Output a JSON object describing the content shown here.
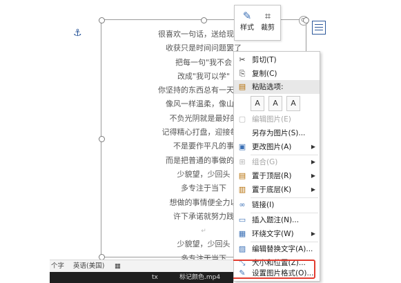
{
  "document": {
    "poem_lines": [
      "很喜欢一句话，送给现在的",
      "收获只是时间问题罢了",
      "把每一句\"我不会",
      "改成\"我可以学\"",
      "你坚持的东西总有一天会反",
      "像风一样温柔，像山一",
      "不负光阴就是最好的",
      "记得精心打盘，迎接每一",
      "不是要作平凡的事",
      "而是把普通的事做的不",
      "少貌望，少回头",
      "多专注于当下",
      "想做的事情便全力以",
      "许下承诺就努力践",
      "",
      "少貌望，少回头",
      "多专注于当下"
    ],
    "paragraph_mark": "↵"
  },
  "mini_toolbar": {
    "style_label": "样式",
    "crop_label": "裁剪"
  },
  "context_menu": {
    "items": [
      {
        "label": "剪切(T)",
        "icon": "scissors-icon",
        "glyph": "✂"
      },
      {
        "label": "复制(C)",
        "icon": "copy-icon",
        "glyph": "⎘"
      },
      {
        "label": "粘贴选项:",
        "icon": "paste-icon",
        "glyph": "📋"
      },
      {
        "label": "编辑图片(E)",
        "icon": "edit-picture-icon",
        "glyph": "▢"
      },
      {
        "label": "另存为图片(S)...",
        "icon": "",
        "glyph": ""
      },
      {
        "label": "更改图片(A)",
        "icon": "change-picture-icon",
        "glyph": "▣"
      },
      {
        "label": "组合(G)",
        "icon": "group-icon",
        "glyph": "⊞"
      },
      {
        "label": "置于顶层(R)",
        "icon": "bring-front-icon",
        "glyph": "▤"
      },
      {
        "label": "置于底层(K)",
        "icon": "send-back-icon",
        "glyph": "▥"
      },
      {
        "label": "链接(I)",
        "icon": "link-icon",
        "glyph": "🔗"
      },
      {
        "label": "插入题注(N)...",
        "icon": "insert-caption-icon",
        "glyph": "▭"
      },
      {
        "label": "环绕文字(W)",
        "icon": "wrap-text-icon",
        "glyph": "▦"
      },
      {
        "label": "编辑替换文字(A)...",
        "icon": "alt-text-icon",
        "glyph": "▨"
      },
      {
        "label": "大小和位置(Z)...",
        "icon": "size-position-icon",
        "glyph": "⤡"
      },
      {
        "label": "设置图片格式(O)...",
        "icon": "format-picture-icon",
        "glyph": "🖌"
      }
    ],
    "paste_options": [
      "A",
      "A",
      "A"
    ]
  },
  "status_bar": {
    "word_count": "个字",
    "language": "英语(美国)",
    "macro_icon": "▦"
  },
  "taskbar": {
    "item1": "tx",
    "item2": "标记颜色.mp4"
  }
}
